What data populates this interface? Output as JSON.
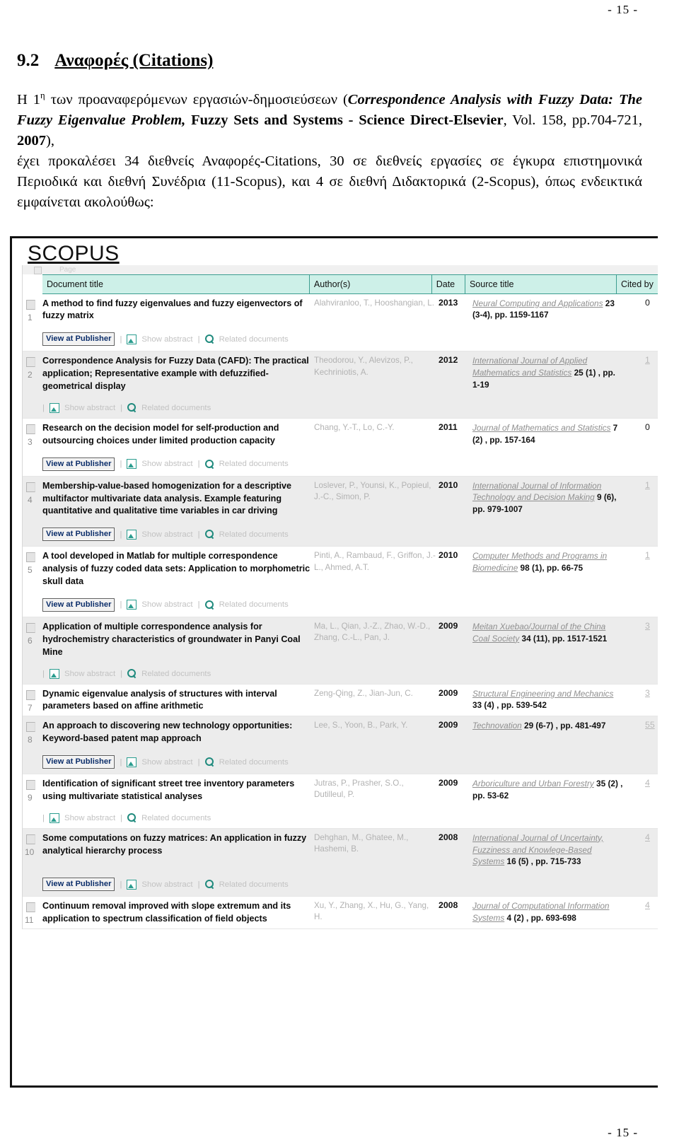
{
  "page": {
    "number_top": "- 15 -",
    "number_bottom": "- 15 -"
  },
  "section": {
    "number": "9.2",
    "title": "Αναφορές  (Citations)"
  },
  "paragraph": {
    "p1_a": "Η 1",
    "p1_sup": "η",
    "p1_b": " των προαναφερόμενων εργασιών-δημοσιεύσεων (",
    "p1_italic_bold_1": "Correspondence Analysis with Fuzzy Data: The Fuzzy Eigenvalue Problem,",
    "p1_bold_1": " Fuzzy Sets and Systems - Science Direct-Elsevier",
    "p1_c": ", Vol. 158, pp.704-721, ",
    "p1_bold_2": "2007",
    "p1_d": "),",
    "p2_a": "έχει προκαλέσει ",
    "p2_bold_italic": "34 διεθνείς Αναφορές-Citations,",
    "p2_b": "  30 σε διεθνείς εργασίες σε έγκυρα επιστημονικά Περιοδικά και διεθνή Συνέδρια ",
    "p2_italic_1": "(11-Scopus)",
    "p2_c": ", και 4 σε διεθνή Διδακτορικά ",
    "p2_italic_2": "(2-Scopus)",
    "p2_d": ", όπως ενδεικτικά εμφαίνεται ακολούθως:"
  },
  "scopus": {
    "brand": "SCOPUS",
    "page_ghost_label": "Page",
    "columns": {
      "title": "Document title",
      "authors": "Author(s)",
      "date": "Date",
      "source": "Source title",
      "cited": "Cited by"
    },
    "actions": {
      "view_at_publisher": "View at Publisher",
      "show_abstract": "Show abstract",
      "related_documents": "Related documents",
      "separator": "|"
    },
    "rows": [
      {
        "num": "1",
        "title": "A method to find fuzzy eigenvalues and fuzzy eigenvectors of fuzzy matrix",
        "authors": "Alahviranloo, T., Hooshangian, L.",
        "date": "2013",
        "source_journal": "Neural Computing and Applications",
        "source_rest": " 23 (3-4), pp. 1159-1167",
        "cited": "0",
        "cited_is_link": false,
        "shaded": false,
        "has_publisher_button": true
      },
      {
        "num": "2",
        "title": "Correspondence Analysis for Fuzzy Data (CAFD): The practical application; Representative example with defuzzified-geometrical display",
        "authors": "Theodorou, Y., Alevizos, P., Kechriniotis, A.",
        "date": "2012",
        "source_journal": "International Journal of Applied Mathematics and Statistics",
        "source_rest": " 25 (1) , pp. 1-19",
        "cited": "1",
        "cited_is_link": true,
        "shaded": true,
        "has_publisher_button": false
      },
      {
        "num": "3",
        "title": "Research on the decision model for self-production and outsourcing choices under limited production capacity",
        "authors": "Chang, Y.-T., Lo, C.-Y.",
        "date": "2011",
        "source_journal": "Journal of Mathematics and Statistics",
        "source_rest": " 7 (2) , pp. 157-164",
        "cited": "0",
        "cited_is_link": false,
        "shaded": false,
        "has_publisher_button": true
      },
      {
        "num": "4",
        "title": "Membership-value-based homogenization for a descriptive multifactor multivariate data analysis. Example featuring quantitative and qualitative time variables in car driving",
        "authors": "Loslever, P., Younsi, K., Popieul, J.-C., Simon, P.",
        "date": "2010",
        "source_journal": "International Journal of Information Technology and Decision Making",
        "source_rest": " 9 (6), pp. 979-1007",
        "cited": "1",
        "cited_is_link": true,
        "shaded": true,
        "has_publisher_button": true
      },
      {
        "num": "5",
        "title": "A tool developed in Matlab for multiple correspondence analysis of fuzzy coded data sets: Application to morphometric skull data",
        "authors": "Pinti, A., Rambaud, F., Griffon, J.-L., Ahmed, A.T.",
        "date": "2010",
        "source_journal": "Computer Methods and Programs in Biomedicine",
        "source_rest": " 98 (1), pp. 66-75",
        "cited": "1",
        "cited_is_link": true,
        "shaded": false,
        "has_publisher_button": true
      },
      {
        "num": "6",
        "title": "Application of multiple correspondence analysis for hydrochemistry characteristics of groundwater in Panyi Coal Mine",
        "authors": "Ma, L., Qian, J.-Z., Zhao, W.-D., Zhang, C.-L., Pan, J.",
        "date": "2009",
        "source_journal": "Meitan Xuebao/Journal of the China Coal Society",
        "source_rest": " 34 (11), pp. 1517-1521",
        "cited": "3",
        "cited_is_link": true,
        "shaded": true,
        "has_publisher_button": false
      },
      {
        "num": "7",
        "title": "Dynamic eigenvalue analysis of structures with interval parameters based on affine arithmetic",
        "authors": "Zeng-Qing, Z., Jian-Jun, C.",
        "date": "2009",
        "source_journal": "Structural Engineering and Mechanics",
        "source_rest": " 33 (4) , pp. 539-542",
        "cited": "3",
        "cited_is_link": true,
        "shaded": false,
        "has_publisher_button": false,
        "no_actions": true
      },
      {
        "num": "8",
        "title": "An approach to discovering new technology opportunities: Keyword-based patent map approach",
        "authors": "Lee, S., Yoon, B., Park, Y.",
        "date": "2009",
        "source_journal": "Technovation",
        "source_rest": " 29 (6-7) , pp. 481-497",
        "cited": "55",
        "cited_is_link": true,
        "shaded": true,
        "has_publisher_button": true
      },
      {
        "num": "9",
        "title": "Identification of significant street tree inventory parameters using multivariate statistical analyses",
        "authors": "Jutras, P., Prasher, S.O., Dutilleul, P.",
        "date": "2009",
        "source_journal": "Arboriculture and Urban Forestry",
        "source_rest": " 35 (2) , pp. 53-62",
        "cited": "4",
        "cited_is_link": true,
        "shaded": false,
        "has_publisher_button": false
      },
      {
        "num": "10",
        "title": "Some computations on fuzzy matrices: An application in fuzzy analytical hierarchy process",
        "authors": "Dehghan, M., Ghatee, M., Hashemi, B.",
        "date": "2008",
        "source_journal": "International Journal of Uncertainty, Fuzziness and Knowlege-Based Systems",
        "source_rest": " 16 (5) , pp. 715-733",
        "cited": "4",
        "cited_is_link": true,
        "shaded": true,
        "has_publisher_button": true
      },
      {
        "num": "11",
        "title": "Continuum removal improved with slope extremum and its application to spectrum classification of field objects",
        "authors": "Xu, Y., Zhang, X., Hu, G., Yang, H.",
        "date": "2008",
        "source_journal": "Journal of Computational Information Systems",
        "source_rest": " 4 (2) , pp. 693-698",
        "cited": "4",
        "cited_is_link": true,
        "shaded": false,
        "has_publisher_button": false,
        "no_actions": true
      }
    ]
  },
  "colors": {
    "header_bg": "#cdf0e8",
    "header_border": "#3c9d90",
    "row_alt_bg": "#ececec",
    "muted_text": "#b2b2b2",
    "icon_teal": "#2a9d8f",
    "link_blue": "#0d2f6b"
  }
}
